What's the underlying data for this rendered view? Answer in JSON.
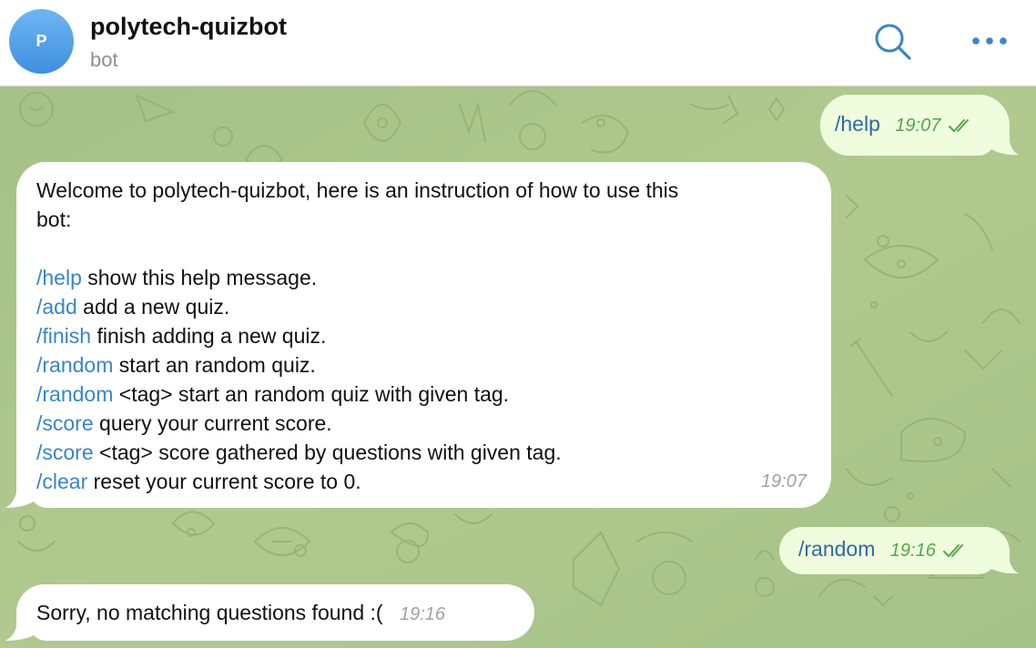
{
  "header": {
    "avatar_letter": "P",
    "title": "polytech-quizbot",
    "subtitle": "bot",
    "icons": {
      "search": "search-icon",
      "more": "more-horizontal-icon"
    },
    "avatar_color": "#4a97e8"
  },
  "colors": {
    "chat_background": "#a9c48b",
    "outgoing_bubble": "#effdde",
    "incoming_bubble": "#ffffff",
    "command_link": "#3a84c9",
    "outgoing_time": "#56a54b"
  },
  "messages": [
    {
      "direction": "outgoing",
      "command": "/help",
      "time": "19:07",
      "status": "read"
    },
    {
      "direction": "incoming",
      "intro": "Welcome to polytech-quizbot, here is an instruction of how to use this",
      "intro2": "bot:",
      "lines": [
        {
          "command": "/help",
          "text": " show this help message."
        },
        {
          "command": "/add",
          "text": " add a new quiz."
        },
        {
          "command": "/finish",
          "text": " finish adding a new quiz."
        },
        {
          "command": "/random",
          "text": " start an random quiz."
        },
        {
          "command": "/random",
          "text": " <tag> start an random quiz with given tag."
        },
        {
          "command": "/score",
          "text": " query your current score."
        },
        {
          "command": "/score",
          "text": " <tag> score gathered by questions with given tag."
        },
        {
          "command": "/clear",
          "text": " reset your current score to 0."
        }
      ],
      "time": "19:07"
    },
    {
      "direction": "outgoing",
      "command": "/random",
      "time": "19:16",
      "status": "read"
    },
    {
      "direction": "incoming",
      "text": "Sorry, no matching questions found :(",
      "time": "19:16"
    }
  ]
}
